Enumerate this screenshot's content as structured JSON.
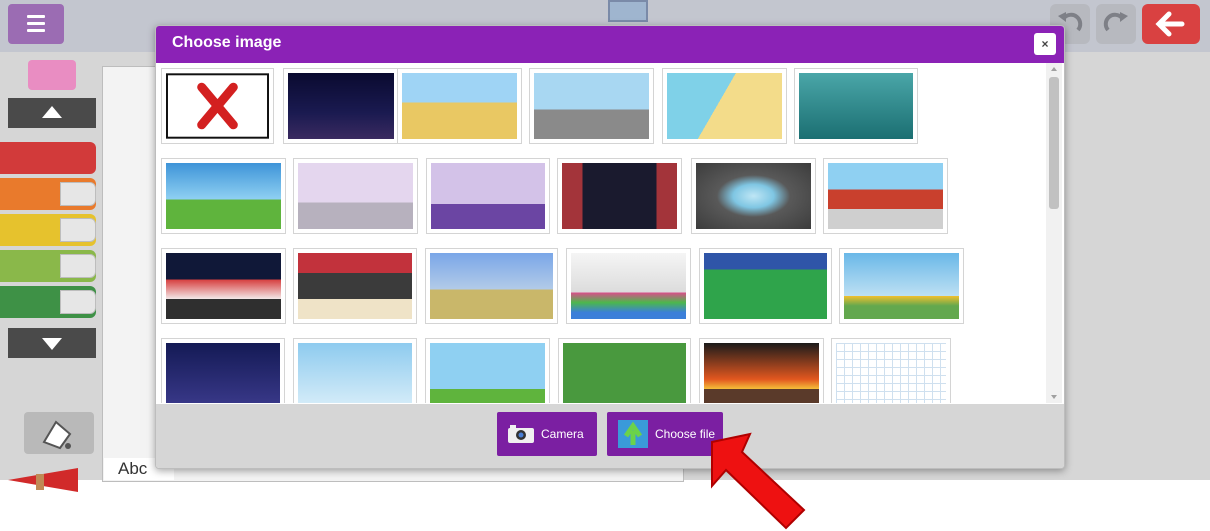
{
  "dialog": {
    "title": "Choose image",
    "close_glyph": "×",
    "buttons": {
      "camera": "Camera",
      "choose_file": "Choose file"
    }
  },
  "canvas": {
    "text_tool_label": "Abc"
  },
  "thumbnails": [
    {
      "name": "no-image",
      "icon": "red-x-icon"
    },
    {
      "name": "night-city"
    },
    {
      "name": "pyramids"
    },
    {
      "name": "london-big-ben"
    },
    {
      "name": "beach"
    },
    {
      "name": "underwater"
    },
    {
      "name": "castle"
    },
    {
      "name": "palace-staircase"
    },
    {
      "name": "bedroom"
    },
    {
      "name": "stage-curtains"
    },
    {
      "name": "cave"
    },
    {
      "name": "forbidden-city"
    },
    {
      "name": "circus-tent"
    },
    {
      "name": "circus-ring"
    },
    {
      "name": "desert-plain"
    },
    {
      "name": "disco-floor"
    },
    {
      "name": "green-field"
    },
    {
      "name": "flower-meadow"
    },
    {
      "name": "fireworks"
    },
    {
      "name": "blue-sky"
    },
    {
      "name": "castle-2"
    },
    {
      "name": "grass"
    },
    {
      "name": "burning-town"
    },
    {
      "name": "grid-paper"
    }
  ],
  "colors": {
    "accent": "#8b22b6",
    "button": "#7b1fa2",
    "back": "#d94141"
  }
}
